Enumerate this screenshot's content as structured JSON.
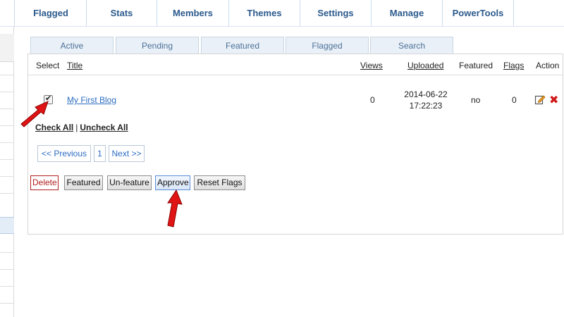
{
  "nav": {
    "items": [
      "Flagged",
      "Stats",
      "Members",
      "Themes",
      "Settings",
      "Manage",
      "PowerTools"
    ]
  },
  "tabs": [
    "Active",
    "Pending",
    "Featured",
    "Flagged",
    "Search"
  ],
  "table": {
    "headers": {
      "select": "Select",
      "title": "Title",
      "views": "Views",
      "uploaded": "Uploaded",
      "featured": "Featured",
      "flags": "Flags",
      "action": "Action"
    },
    "row": {
      "title": "My First Blog",
      "views": "0",
      "uploaded_date": "2014-06-22",
      "uploaded_time": "17:22:23",
      "featured": "no",
      "flags": "0",
      "checked": true
    }
  },
  "select_links": {
    "check_all": "Check All",
    "separator": "|",
    "uncheck_all": "Uncheck All"
  },
  "pager": {
    "previous": "<< Previous",
    "page": "1",
    "next": "Next >>"
  },
  "buttons": {
    "delete": "Delete",
    "featured": "Featured",
    "unfeature": "Un-feature",
    "approve": "Approve",
    "reset_flags": "Reset Flags"
  },
  "icons": {
    "edit": "edit-icon",
    "delete": "delete-icon",
    "arrow": "red-arrow-annotation"
  },
  "colors": {
    "nav_text": "#2c5a8c",
    "link": "#2d6cc0",
    "delete_red": "#b21e1e",
    "arrow_red": "#e01414"
  }
}
